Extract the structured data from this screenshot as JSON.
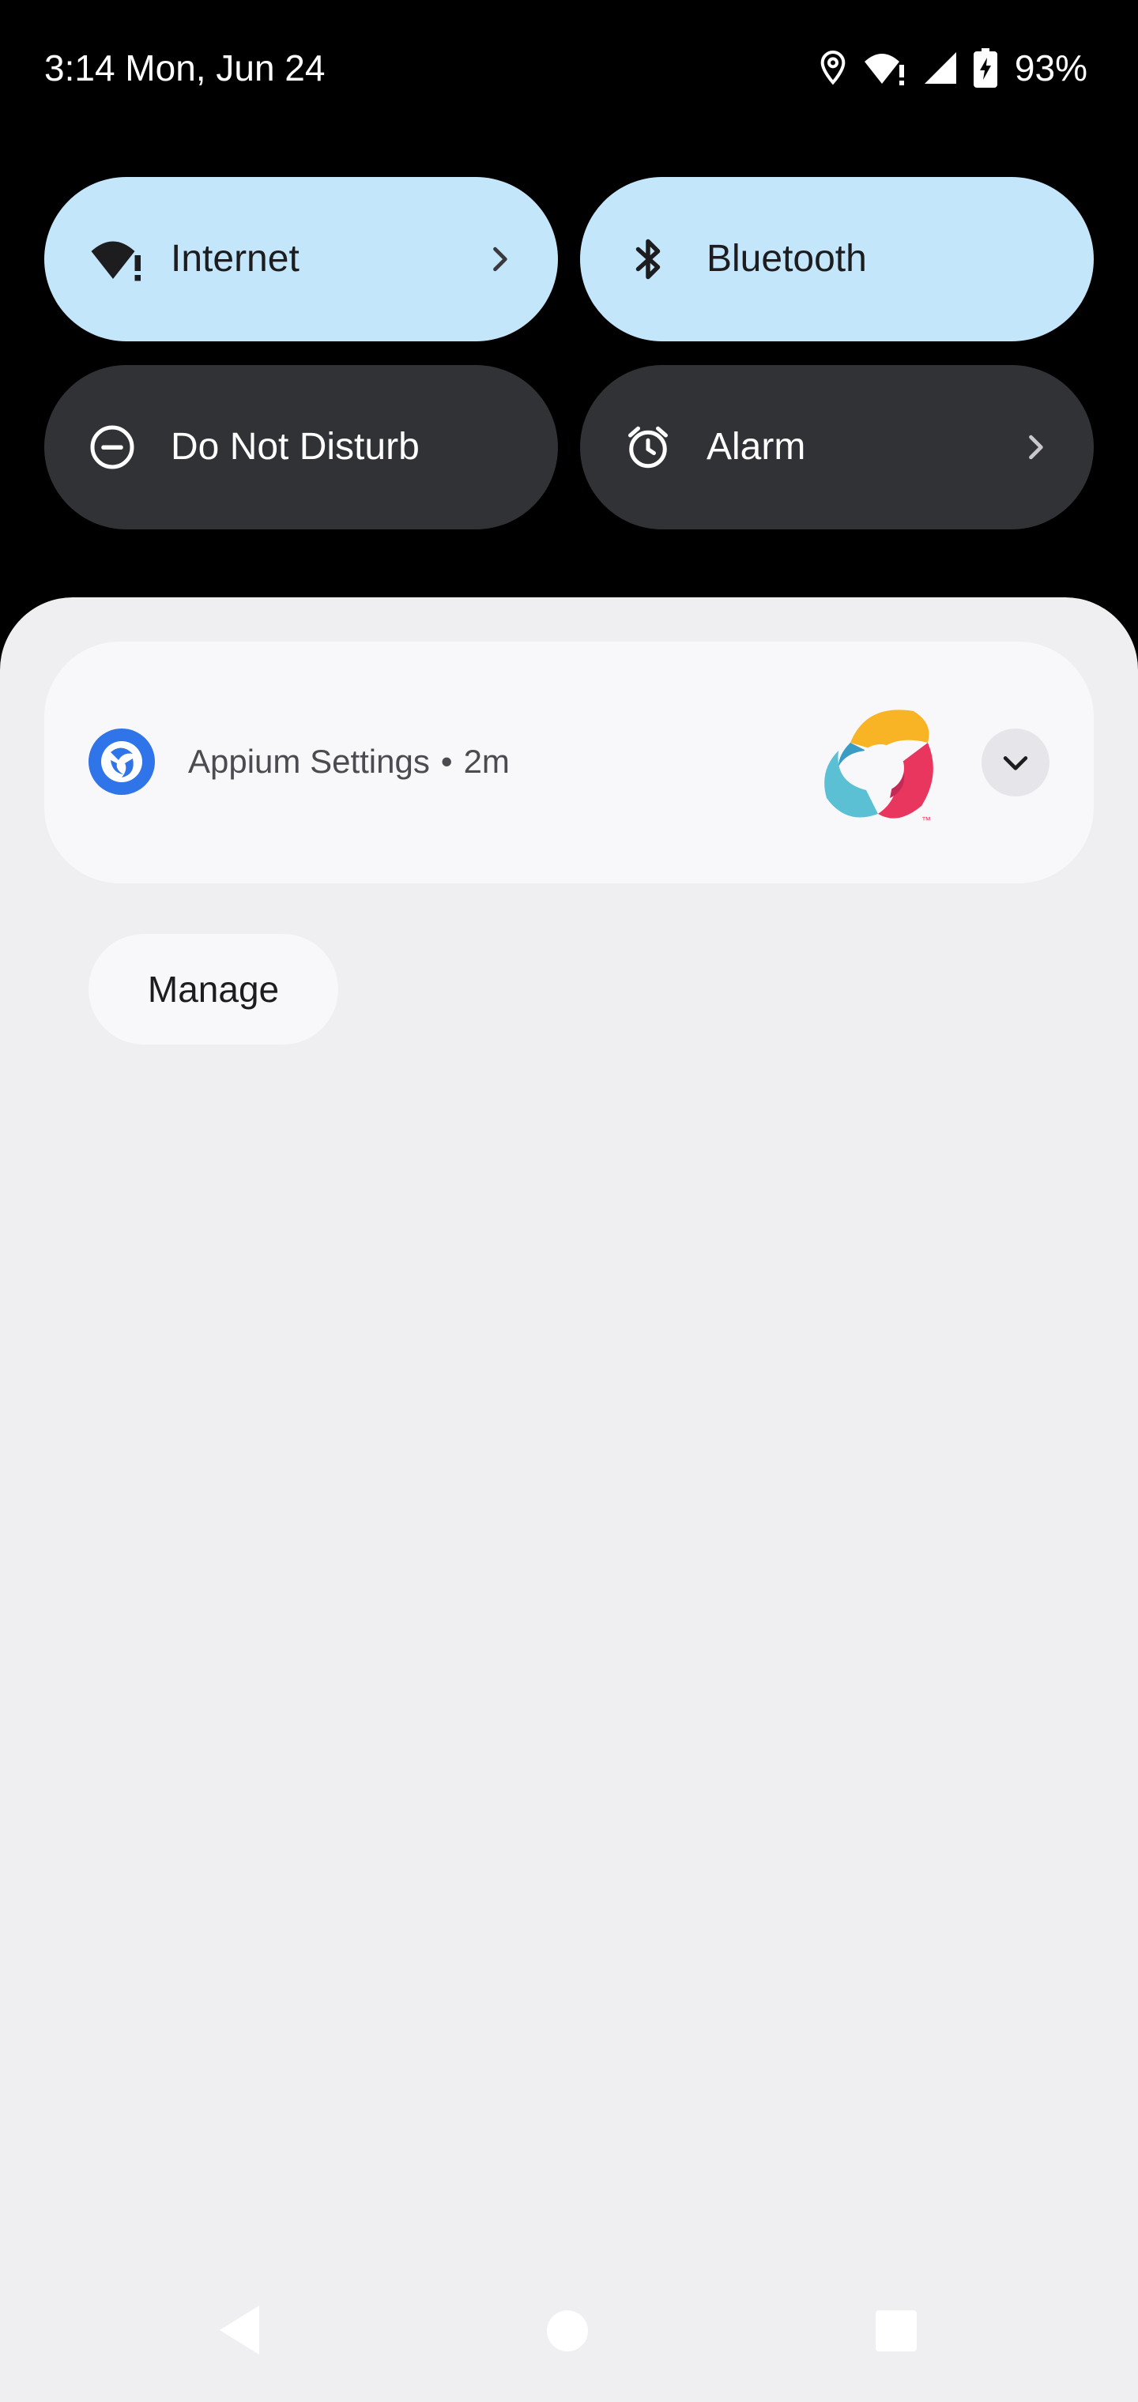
{
  "status_bar": {
    "time_date": "3:14 Mon, Jun 24",
    "icons": [
      "location-icon",
      "wifi-alert-icon",
      "cell-signal-icon",
      "battery-charging-icon"
    ],
    "battery_percent": "93%"
  },
  "quick_settings": {
    "tiles": [
      {
        "label": "Internet",
        "icon": "wifi-alert-icon",
        "state": "on",
        "has_chevron": true
      },
      {
        "label": "Bluetooth",
        "icon": "bluetooth-icon",
        "state": "on",
        "has_chevron": false
      },
      {
        "label": "Do Not Disturb",
        "icon": "do-not-disturb-icon",
        "state": "off",
        "has_chevron": false
      },
      {
        "label": "Alarm",
        "icon": "alarm-clock-icon",
        "state": "off",
        "has_chevron": true
      }
    ]
  },
  "notification": {
    "app_icon": "appium-settings-app-icon",
    "app_name": "Appium Settings",
    "separator": "•",
    "time": "2m",
    "large_icon": "appium-logo-icon",
    "expand_icon": "chevron-down-icon"
  },
  "manage_button": {
    "label": "Manage"
  },
  "navigation_bar": {
    "buttons": [
      "back-icon",
      "home-icon",
      "recents-icon"
    ]
  },
  "colors": {
    "tile_on": "#c3e6fb",
    "tile_off": "#303236",
    "shade_background": "#efeff2",
    "card_background": "#f8f8fa",
    "app_icon_blue": "#2f74e8"
  }
}
